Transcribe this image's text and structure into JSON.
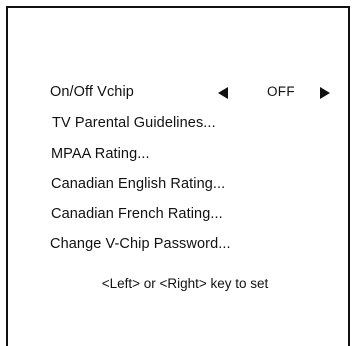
{
  "menu": {
    "items": [
      "On/Off Vchip",
      "TV Parental Guidelines...",
      "MPAA Rating...",
      "Canadian English Rating...",
      "Canadian French Rating...",
      "Change V-Chip Password..."
    ],
    "vchip_value": "OFF"
  },
  "icons": {
    "left": "left-arrow-icon",
    "right": "right-arrow-icon"
  },
  "footer": {
    "hint": "<Left> or <Right> key to set"
  },
  "colors": {
    "text": "#111111",
    "background": "#ffffff",
    "border": "#111111"
  }
}
